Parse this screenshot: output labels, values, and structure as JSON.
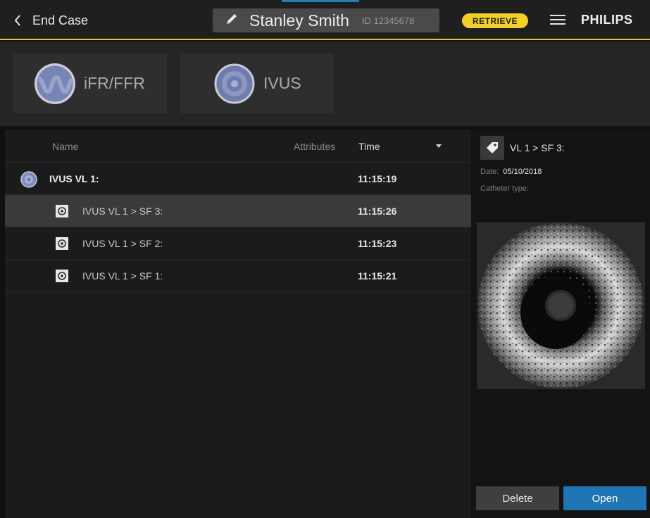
{
  "header": {
    "back_label": "End Case",
    "patient_name": "Stanley Smith",
    "patient_id_prefix": "ID",
    "patient_id": "12345678",
    "retrieve_label": "RETRIEVE",
    "brand": "PHILIPS",
    "accent_color": "#e8c21a"
  },
  "modalities": [
    {
      "label": "iFR/FFR",
      "icon": "waveform-icon"
    },
    {
      "label": "IVUS",
      "icon": "ivus-ring-icon"
    }
  ],
  "list": {
    "columns": {
      "name": "Name",
      "attributes": "Attributes",
      "time": "Time"
    },
    "rows": [
      {
        "name": "IVUS VL 1:",
        "time": "11:15:19",
        "level": "parent",
        "icon": "ivus-disc-icon"
      },
      {
        "name": "IVUS VL 1 > SF 3:",
        "time": "11:15:26",
        "level": "child",
        "icon": "frame-icon",
        "selected": true
      },
      {
        "name": "IVUS VL 1 > SF 2:",
        "time": "11:15:23",
        "level": "child",
        "icon": "frame-icon"
      },
      {
        "name": "IVUS VL 1 > SF 1:",
        "time": "11:15:21",
        "level": "child",
        "icon": "frame-icon"
      }
    ]
  },
  "detail": {
    "title": "VL 1 > SF 3:",
    "date_label": "Date:",
    "date_value": "05/10/2018",
    "catheter_label": "Catheter type:",
    "delete_label": "Delete",
    "open_label": "Open",
    "open_color": "#1e76b4"
  }
}
